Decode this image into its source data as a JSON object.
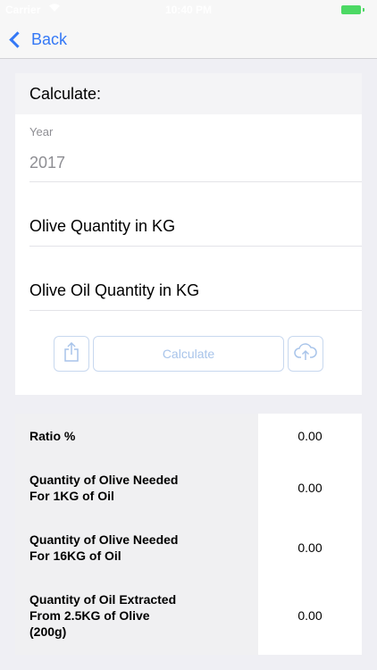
{
  "status_bar": {
    "carrier": "Carrier",
    "time": "10:40 PM"
  },
  "nav": {
    "back_label": "Back"
  },
  "calculate": {
    "header": "Calculate:",
    "year_caption": "Year",
    "year_value": "2017",
    "olive_placeholder": "Olive Quantity in KG",
    "oil_placeholder": "Olive Oil Quantity in KG",
    "calculate_button": "Calculate"
  },
  "results": {
    "rows": [
      {
        "label": "Ratio %",
        "value": "0.00"
      },
      {
        "label": "Quantity of Olive Needed For 1KG of Oil",
        "value": "0.00"
      },
      {
        "label": "Quantity of Olive Needed For 16KG of Oil",
        "value": "0.00"
      },
      {
        "label": "Quantity of Oil Extracted From 2.5KG of Olive (200g)",
        "value": "0.00"
      }
    ]
  },
  "colors": {
    "accent": "#3478f6",
    "battery": "#4cd964"
  }
}
